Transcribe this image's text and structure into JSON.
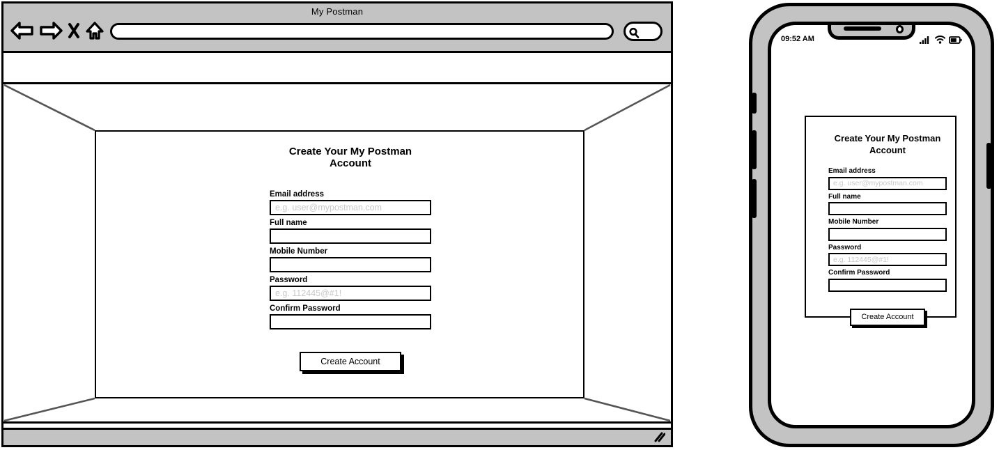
{
  "browser": {
    "title": "My Postman",
    "url_value": "",
    "url_placeholder": "",
    "nav_icons": [
      "back-arrow-icon",
      "forward-arrow-icon",
      "close-x-icon",
      "home-icon"
    ],
    "search_icon": "magnifier-icon",
    "resize_grip": "resize-grip-icon"
  },
  "form": {
    "title": "Create Your My Postman Account",
    "fields": [
      {
        "label": "Email address",
        "value": "",
        "placeholder": "e.g. user@mypostman.com",
        "type": "email"
      },
      {
        "label": "Full name",
        "value": "",
        "placeholder": "",
        "type": "text"
      },
      {
        "label": "Mobile Number",
        "value": "",
        "placeholder": "",
        "type": "tel"
      },
      {
        "label": "Password",
        "value": "",
        "placeholder": "e.g. 112445@#1!",
        "type": "text"
      },
      {
        "label": "Confirm Password",
        "value": "",
        "placeholder": "",
        "type": "text"
      }
    ],
    "submit_label": "Create Account"
  },
  "phone": {
    "status": {
      "time": "09:52 AM",
      "signal_icon": "signal-bars-icon",
      "wifi_icon": "wifi-icon",
      "battery_icon": "battery-icon"
    }
  },
  "colors": {
    "chrome_gray": "#c3c3c3",
    "outline": "#000000",
    "placeholder": "#c9c9c9",
    "perspective_line": "#555555"
  }
}
